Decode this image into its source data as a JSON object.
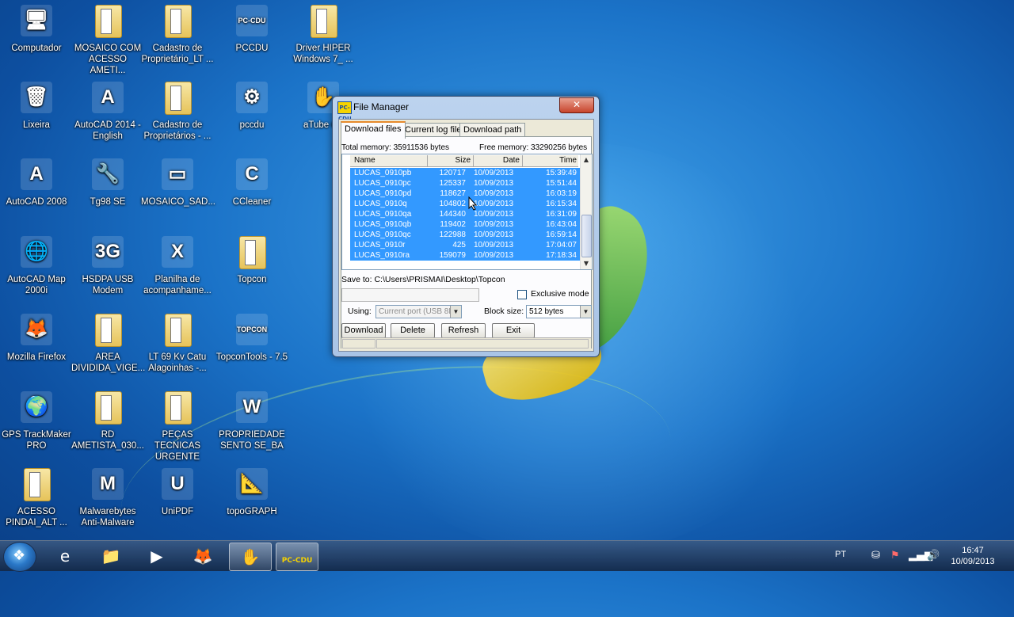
{
  "desktop": {
    "icons": [
      {
        "label": "Computador",
        "glyph": "🖥"
      },
      {
        "label": "MOSAICO COM ACESSO AMETI...",
        "glyph": "folder"
      },
      {
        "label": "Cadastro de Proprietário_LT ...",
        "glyph": "folder"
      },
      {
        "label": "PCCDU",
        "glyph": "PC-CDU"
      },
      {
        "label": "Driver HIPER Windows 7_ ...",
        "glyph": "folder"
      },
      {
        "label": "Lixeira",
        "glyph": "🗑"
      },
      {
        "label": "AutoCAD 2014 - English",
        "glyph": "A"
      },
      {
        "label": "Cadastro de Proprietários - ...",
        "glyph": "folder"
      },
      {
        "label": "pccdu",
        "glyph": "⚙"
      },
      {
        "label": "aTube Ca",
        "glyph": "✋"
      },
      {
        "label": "AutoCAD 2008",
        "glyph": "A"
      },
      {
        "label": "Tg98 SE",
        "glyph": "🔧"
      },
      {
        "label": "MOSAICO_SAD...",
        "glyph": "▭"
      },
      {
        "label": "CCleaner",
        "glyph": "C"
      },
      {
        "label": "AutoCAD Map 2000i",
        "glyph": "🌐"
      },
      {
        "label": "HSDPA USB Modem",
        "glyph": "3G"
      },
      {
        "label": "Planilha de acompanhame...",
        "glyph": "X"
      },
      {
        "label": "Topcon",
        "glyph": "folder"
      },
      {
        "label": "Mozilla Firefox",
        "glyph": "🦊"
      },
      {
        "label": "AREA DIVIDIDA_VIGE...",
        "glyph": "folder"
      },
      {
        "label": "LT 69 Kv Catu Alagoinhas -...",
        "glyph": "folder"
      },
      {
        "label": "TopconTools - 7.5",
        "glyph": "TOPCON"
      },
      {
        "label": "GPS TrackMaker PRO",
        "glyph": "🌍"
      },
      {
        "label": "RD AMETISTA_030...",
        "glyph": "folder"
      },
      {
        "label": "PEÇAS TECNICAS URGENTE",
        "glyph": "folder"
      },
      {
        "label": "PROPRIEDADE SENTO SE_BA",
        "glyph": "W"
      },
      {
        "label": "ACESSO PINDAI_ALT ...",
        "glyph": "folder"
      },
      {
        "label": "Malwarebytes Anti-Malware",
        "glyph": "M"
      },
      {
        "label": "UniPDF",
        "glyph": "U"
      },
      {
        "label": "topoGRAPH",
        "glyph": "📐"
      }
    ]
  },
  "window": {
    "title": "File Manager",
    "app_icon": "PC-CDU",
    "close_glyph": "✕",
    "tabs": [
      {
        "label": "Download files",
        "active": true
      },
      {
        "label": "Current log file",
        "active": false
      },
      {
        "label": "Download path",
        "active": false
      }
    ],
    "total_memory": "Total memory: 35911536 bytes",
    "free_memory": "Free memory: 33290256 bytes",
    "columns": [
      "Name",
      "Size",
      "Date",
      "Time"
    ],
    "rows": [
      {
        "name": "LUCAS_0910pb",
        "size": "120717",
        "date": "10/09/2013",
        "time": "15:39:49"
      },
      {
        "name": "LUCAS_0910pc",
        "size": "125337",
        "date": "10/09/2013",
        "time": "15:51:44"
      },
      {
        "name": "LUCAS_0910pd",
        "size": "118627",
        "date": "10/09/2013",
        "time": "16:03:19"
      },
      {
        "name": "LUCAS_0910q",
        "size": "104802",
        "date": "10/09/2013",
        "time": "16:15:34"
      },
      {
        "name": "LUCAS_0910qa",
        "size": "144340",
        "date": "10/09/2013",
        "time": "16:31:09"
      },
      {
        "name": "LUCAS_0910qb",
        "size": "119402",
        "date": "10/09/2013",
        "time": "16:43:04"
      },
      {
        "name": "LUCAS_0910qc",
        "size": "122988",
        "date": "10/09/2013",
        "time": "16:59:14"
      },
      {
        "name": "LUCAS_0910r",
        "size": "425",
        "date": "10/09/2013",
        "time": "17:04:07"
      },
      {
        "name": "LUCAS_0910ra",
        "size": "159079",
        "date": "10/09/2013",
        "time": "17:18:34"
      }
    ],
    "save_to": "Save to: C:\\Users\\PRISMAI\\Desktop\\Topcon",
    "exclusive_mode": "Exclusive mode",
    "using_label": "Using:",
    "port_value": "Current port (USB 8F",
    "block_size_label": "Block size:",
    "block_size_value": "512 bytes",
    "buttons": {
      "download": "Download",
      "delete": "Delete",
      "refresh": "Refresh",
      "exit": "Exit"
    }
  },
  "taskbar": {
    "language": "PT",
    "time": "16:47",
    "date": "10/09/2013",
    "items": [
      {
        "name": "internet-explorer",
        "glyph": "e"
      },
      {
        "name": "windows-explorer",
        "glyph": "📁"
      },
      {
        "name": "media-player",
        "glyph": "▶"
      },
      {
        "name": "firefox",
        "glyph": "🦊"
      },
      {
        "name": "atube-catcher",
        "glyph": "✋"
      },
      {
        "name": "pccdu",
        "glyph": "PC-CDU"
      }
    ]
  }
}
